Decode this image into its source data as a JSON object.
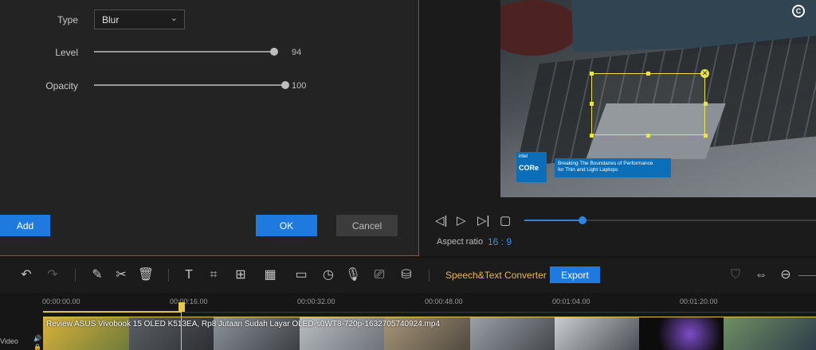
{
  "dialog": {
    "type_label": "Type",
    "type_value": "Blur",
    "level_label": "Level",
    "level_value": "94",
    "opacity_label": "Opacity",
    "opacity_value": "100",
    "add_label": "Add",
    "ok_label": "OK",
    "cancel_label": "Cancel"
  },
  "preview": {
    "intel_brand": "intel",
    "intel_core": "CORe",
    "caption_line1": "Breaking The Boundaries of Performance",
    "caption_line2": "for Thin and Light Laptops",
    "aspect_label": "Aspect ratio",
    "aspect_value": "16 : 9",
    "progress": 0.2
  },
  "toolbar": {
    "speech_label": "Speech&Text Converter",
    "export_label": "Export"
  },
  "timeline": {
    "ticks": [
      "00:00:00.00",
      "00:00:16.00",
      "00:00:32.00",
      "00:00:48.00",
      "00:01:04.00",
      "00:01:20.00"
    ],
    "clip_title": "Review ASUS Vivobook 15 OLED K513EA, Rp8 Jutaan Sudah Layar OLED-s0WT8-720p-1632705740924.mp4",
    "track_label": "Video"
  },
  "colors": {
    "accent": "#1f7ae0",
    "selection": "#e8e44a",
    "speech": "#e8b84a"
  }
}
